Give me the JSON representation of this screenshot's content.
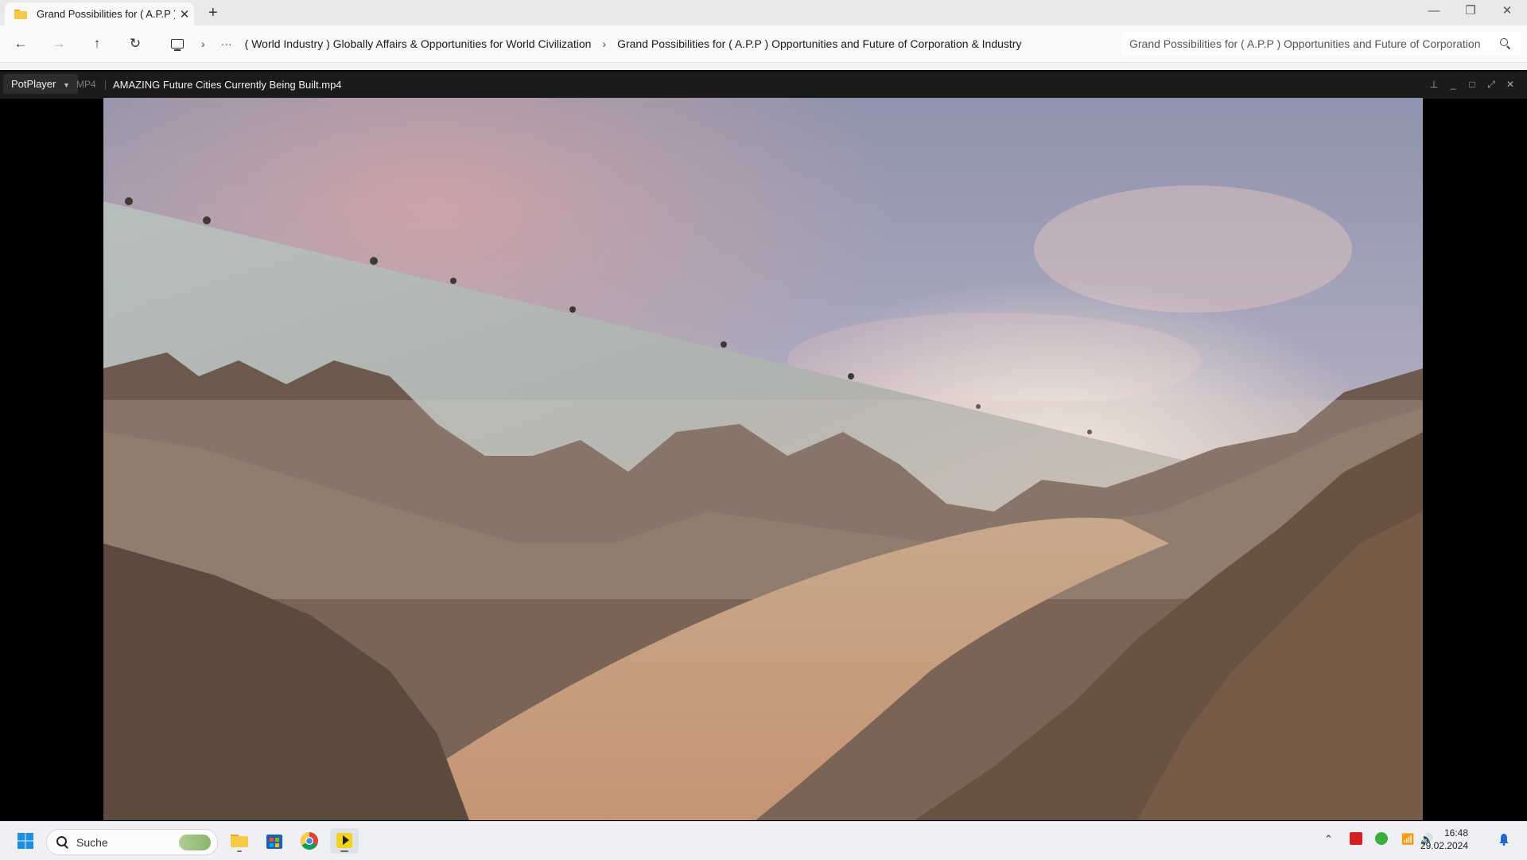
{
  "explorer": {
    "tab_title": "Grand Possibilities for ( A.P.P )",
    "new_tab_icon": "plus-icon",
    "breadcrumb": [
      "( World Industry ) Globally Affairs & Opportunities for World Civilization",
      "Grand Possibilities for ( A.P.P ) Opportunities and Future of Corporation & Industry"
    ],
    "search_text": "Grand Possibilities for ( A.P.P ) Opportunities and Future of Corporation"
  },
  "player": {
    "app_name": "PotPlayer",
    "format": "MP4",
    "file_name": "AMAZING Future Cities Currently Being Built.mp4"
  },
  "taskbar": {
    "search_label": "Suche",
    "time": "16:48",
    "date": "29.02.2024"
  },
  "colors": {
    "accent": "#0067c0",
    "folder": "#f7c948",
    "player_bg": "#000000"
  }
}
